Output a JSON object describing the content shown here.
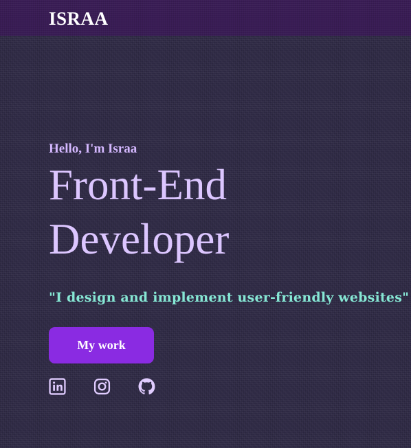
{
  "navbar": {
    "logo": "ISRAA"
  },
  "hero": {
    "greeting": "Hello, I'm Israa",
    "role_line1": "Front-End",
    "role_line2": "Developer",
    "tagline": "\"I design and implement user-friendly websites\"",
    "cta_label": "My work"
  },
  "socials": [
    {
      "icon": "linkedin-icon"
    },
    {
      "icon": "instagram-icon"
    },
    {
      "icon": "github-icon"
    }
  ],
  "colors": {
    "background": "#2f2a45",
    "navbar": "#391c55",
    "accent": "#8a2be2",
    "heading": "#dcc6ff",
    "tagline": "#86e7d4",
    "icon": "#e0ccff"
  }
}
